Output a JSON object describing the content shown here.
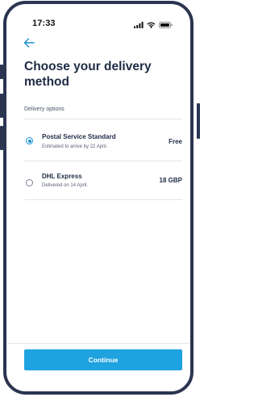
{
  "status_bar": {
    "time": "17:33",
    "icons": [
      "signal-icon",
      "wifi-icon",
      "battery-icon"
    ]
  },
  "header": {
    "back_icon": "arrow-left-icon",
    "title": "Choose your delivery method"
  },
  "delivery": {
    "section_label": "Delivery options",
    "options": [
      {
        "name": "Postal Service Standard",
        "subtitle": "Estimated to arrive by 22 April.",
        "price": "Free",
        "selected": true
      },
      {
        "name": "DHL Express",
        "subtitle": "Delivered on 14 April.",
        "price": "18 GBP",
        "selected": false
      }
    ]
  },
  "footer": {
    "continue_label": "Continue"
  },
  "colors": {
    "frame": "#2b3551",
    "accent": "#1fa2e0",
    "radio_selected": "#1a8fd0",
    "title_text": "#1f2b45",
    "divider": "#e3e6ec"
  }
}
